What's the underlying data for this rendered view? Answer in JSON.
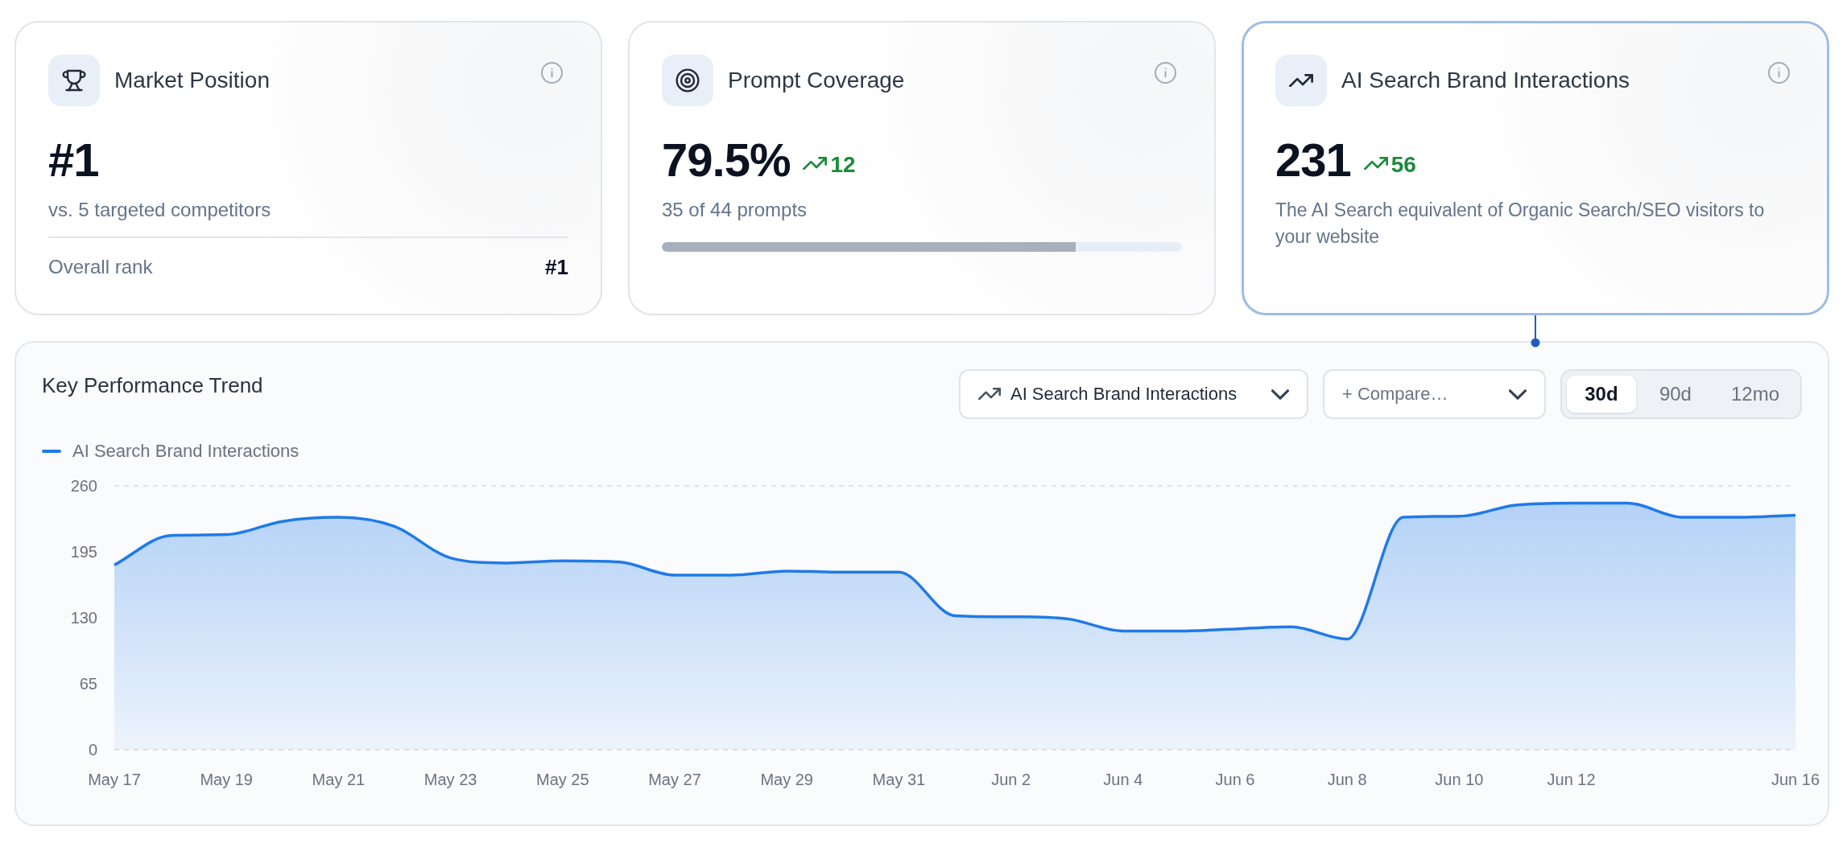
{
  "cards": [
    {
      "kind": "rank",
      "title": "Market Position",
      "value": "#1",
      "subtitle": "vs. 5 targeted competitors",
      "footer_label": "Overall rank",
      "footer_value": "#1",
      "selected": false
    },
    {
      "kind": "coverage",
      "title": "Prompt Coverage",
      "value": "79.5%",
      "delta": "12",
      "subtitle": "35 of 44 prompts",
      "level": 0.795,
      "selected": false
    },
    {
      "kind": "trend",
      "title": "AI Search Brand Interactions",
      "value": "231",
      "delta": "56",
      "description": "The AI Search equivalent of Organic Search/SEO visitors to your website",
      "selected": true
    }
  ],
  "trend": {
    "title": "Key Performance Trend",
    "metric_select": {
      "value": "AI Search Brand Interactions"
    },
    "compare_select": {
      "placeholder": "+ Compare…"
    },
    "ranges": [
      {
        "label": "30d",
        "selected": true
      },
      {
        "label": "90d",
        "selected": false
      },
      {
        "label": "12mo",
        "selected": false
      }
    ],
    "chart_data": {
      "type": "area",
      "categories": [
        "May 17",
        null,
        "May 19",
        null,
        "May 21",
        null,
        "May 23",
        null,
        "May 25",
        null,
        "May 27",
        null,
        "May 29",
        null,
        "May 31",
        null,
        "Jun 2",
        null,
        "Jun 4",
        null,
        "Jun 6",
        null,
        "Jun 8",
        null,
        "Jun 10",
        null,
        "Jun 12",
        null,
        null,
        null,
        "Jun 16"
      ],
      "series": [
        {
          "name": "AI Search Brand Interactions",
          "color": "#1f7ae8",
          "values": [
            182,
            211,
            212,
            225,
            229,
            220,
            189,
            184,
            186,
            185,
            172,
            172,
            176,
            175,
            175,
            132,
            131,
            129,
            117,
            117,
            119,
            121,
            109,
            229,
            230,
            241,
            243,
            243,
            229,
            229,
            231
          ]
        }
      ],
      "ylim": [
        0,
        260
      ],
      "yticks": [
        0,
        65,
        130,
        195,
        260
      ]
    }
  }
}
